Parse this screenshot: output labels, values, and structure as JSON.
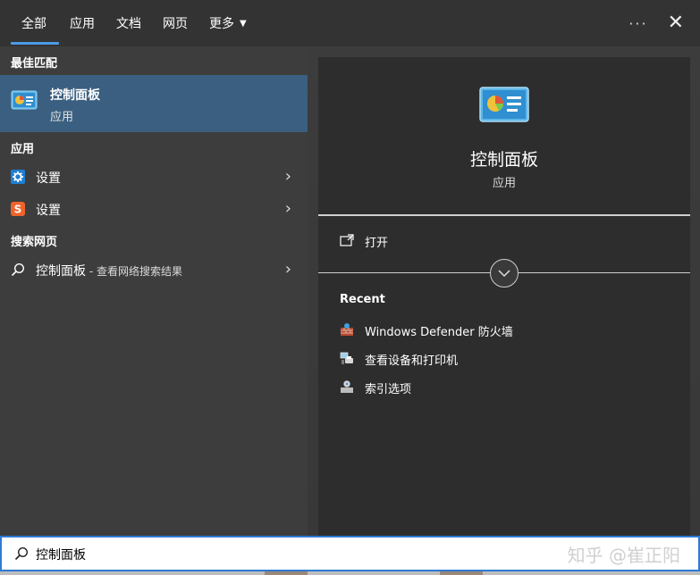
{
  "tabs": [
    {
      "label": "全部",
      "active": true
    },
    {
      "label": "应用",
      "active": false
    },
    {
      "label": "文档",
      "active": false
    },
    {
      "label": "网页",
      "active": false
    },
    {
      "label": "更多",
      "active": false
    }
  ],
  "tab_actions": {
    "more": "···",
    "close": "✕"
  },
  "left": {
    "best_match_title": "最佳匹配",
    "best_match": {
      "name": "控制面板",
      "type": "应用"
    },
    "apps_title": "应用",
    "apps": [
      {
        "label": "设置",
        "icon": "gear-icon"
      },
      {
        "label": "设置",
        "icon": "sogou-settings-icon"
      }
    ],
    "web_title": "搜索网页",
    "web_result": {
      "label": "控制面板",
      "sub": " - 查看网络搜索结果"
    }
  },
  "right": {
    "title": "控制面板",
    "type": "应用",
    "open_label": "打开",
    "recent_title": "Recent",
    "recent": [
      {
        "label": "Windows Defender 防火墙",
        "icon": "firewall-icon"
      },
      {
        "label": "查看设备和打印机",
        "icon": "devices-printers-icon"
      },
      {
        "label": "索引选项",
        "icon": "indexing-options-icon"
      }
    ]
  },
  "search": {
    "value": "控制面板"
  },
  "watermark": "知乎 @崔正阳",
  "colors": {
    "accent": "#4c9be8",
    "selection": "#3a5f80",
    "search_border": "#2f7ad6"
  }
}
